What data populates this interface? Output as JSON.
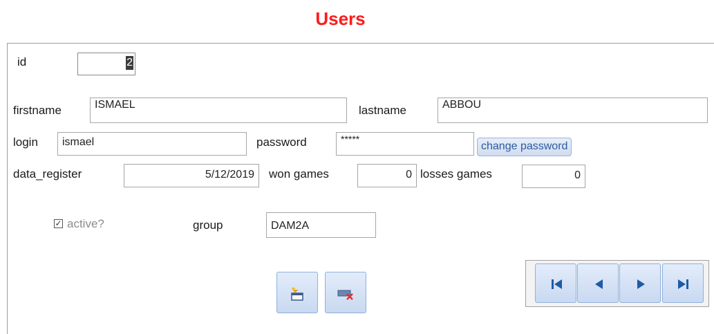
{
  "title": "Users",
  "fields": {
    "id": {
      "label": "id",
      "value": "2"
    },
    "firstname": {
      "label": "firstname",
      "value": "ISMAEL"
    },
    "lastname": {
      "label": "lastname",
      "value": "ABBOU"
    },
    "login": {
      "label": "login",
      "value": "ismael"
    },
    "password": {
      "label": "password",
      "value": "*****"
    },
    "data_register": {
      "label": "data_register",
      "value": "5/12/2019"
    },
    "won_games": {
      "label": "won games",
      "value": "0"
    },
    "losses_games": {
      "label": "losses games",
      "value": "0"
    },
    "active": {
      "label": "active?",
      "checked": true
    },
    "group": {
      "label": "group",
      "value": "DAM2A"
    }
  },
  "buttons": {
    "change_password": "change password",
    "new_record_icon": "new-record-icon",
    "delete_record_icon": "delete-record-icon"
  },
  "navigation": {
    "icons": [
      "first-record-icon",
      "previous-record-icon",
      "next-record-icon",
      "last-record-icon"
    ]
  },
  "colors": {
    "title": "#ff1a1a",
    "button_blue": "#2d5a9e",
    "button_border": "#8fb0dc"
  }
}
